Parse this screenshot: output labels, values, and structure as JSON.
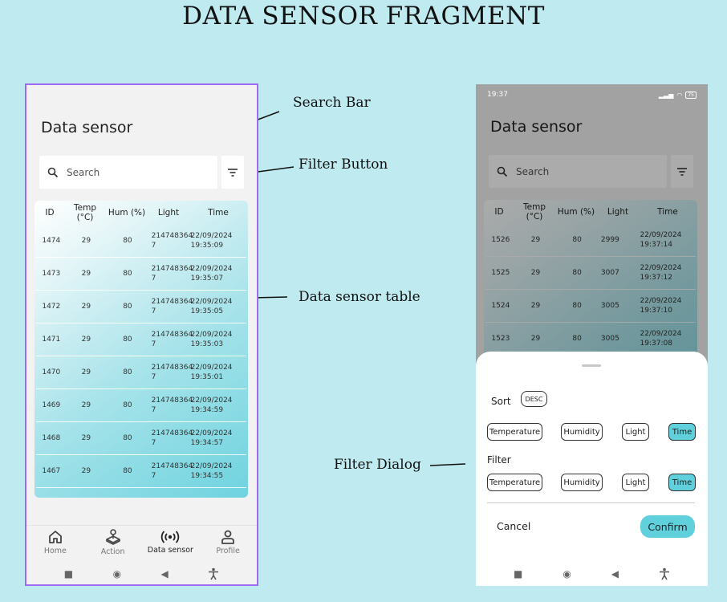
{
  "title": "DATA SENSOR FRAGMENT",
  "annotations": {
    "search_bar": "Search Bar",
    "filter_button": "Filter Button",
    "data_table": "Data sensor table",
    "filter_dialog": "Filter Dialog"
  },
  "colors": {
    "background": "#bfeaf0",
    "accent": "#5fd0dc",
    "frame": "#9e6af0"
  },
  "left_phone": {
    "screen_title": "Data sensor",
    "search_placeholder": "Search",
    "table": {
      "headers": [
        "ID",
        "Temp (°C)",
        "Hum (%)",
        "Light",
        "Time"
      ],
      "rows": [
        {
          "id": "1474",
          "temp": "29",
          "hum": "80",
          "light": "214748364 7",
          "date": "22/09/2024",
          "time": "19:35:09"
        },
        {
          "id": "1473",
          "temp": "29",
          "hum": "80",
          "light": "214748364 7",
          "date": "22/09/2024",
          "time": "19:35:07"
        },
        {
          "id": "1472",
          "temp": "29",
          "hum": "80",
          "light": "214748364 7",
          "date": "22/09/2024",
          "time": "19:35:05"
        },
        {
          "id": "1471",
          "temp": "29",
          "hum": "80",
          "light": "214748364 7",
          "date": "22/09/2024",
          "time": "19:35:03"
        },
        {
          "id": "1470",
          "temp": "29",
          "hum": "80",
          "light": "214748364 7",
          "date": "22/09/2024",
          "time": "19:35:01"
        },
        {
          "id": "1469",
          "temp": "29",
          "hum": "80",
          "light": "214748364 7",
          "date": "22/09/2024",
          "time": "19:34:59"
        },
        {
          "id": "1468",
          "temp": "29",
          "hum": "80",
          "light": "214748364 7",
          "date": "22/09/2024",
          "time": "19:34:57"
        },
        {
          "id": "1467",
          "temp": "29",
          "hum": "80",
          "light": "214748364 7",
          "date": "22/09/2024",
          "time": "19:34:55"
        }
      ]
    },
    "nav": [
      {
        "label": "Home",
        "icon": "home-icon"
      },
      {
        "label": "Action",
        "icon": "joystick-icon"
      },
      {
        "label": "Data sensor",
        "icon": "broadcast-icon"
      },
      {
        "label": "Profile",
        "icon": "person-icon"
      }
    ]
  },
  "right_phone": {
    "status_time": "19:37",
    "battery": "75",
    "screen_title": "Data sensor",
    "search_placeholder": "Search",
    "table": {
      "headers": [
        "ID",
        "Temp (°C)",
        "Hum (%)",
        "Light",
        "Time"
      ],
      "rows": [
        {
          "id": "1526",
          "temp": "29",
          "hum": "80",
          "light": "2999",
          "date": "22/09/2024",
          "time": "19:37:14"
        },
        {
          "id": "1525",
          "temp": "29",
          "hum": "80",
          "light": "3007",
          "date": "22/09/2024",
          "time": "19:37:12"
        },
        {
          "id": "1524",
          "temp": "29",
          "hum": "80",
          "light": "3005",
          "date": "22/09/2024",
          "time": "19:37:10"
        },
        {
          "id": "1523",
          "temp": "29",
          "hum": "80",
          "light": "3005",
          "date": "22/09/2024",
          "time": "19:37:08"
        }
      ]
    },
    "dialog": {
      "sort_label": "Sort",
      "sort_order": "DESC",
      "filter_label": "Filter",
      "sort_options": [
        "Temperature",
        "Humidity",
        "Light",
        "Time"
      ],
      "filter_options": [
        "Temperature",
        "Humidity",
        "Light",
        "Time"
      ],
      "selected_sort": "Time",
      "selected_filter": "Time",
      "cancel": "Cancel",
      "confirm": "Confirm"
    }
  }
}
